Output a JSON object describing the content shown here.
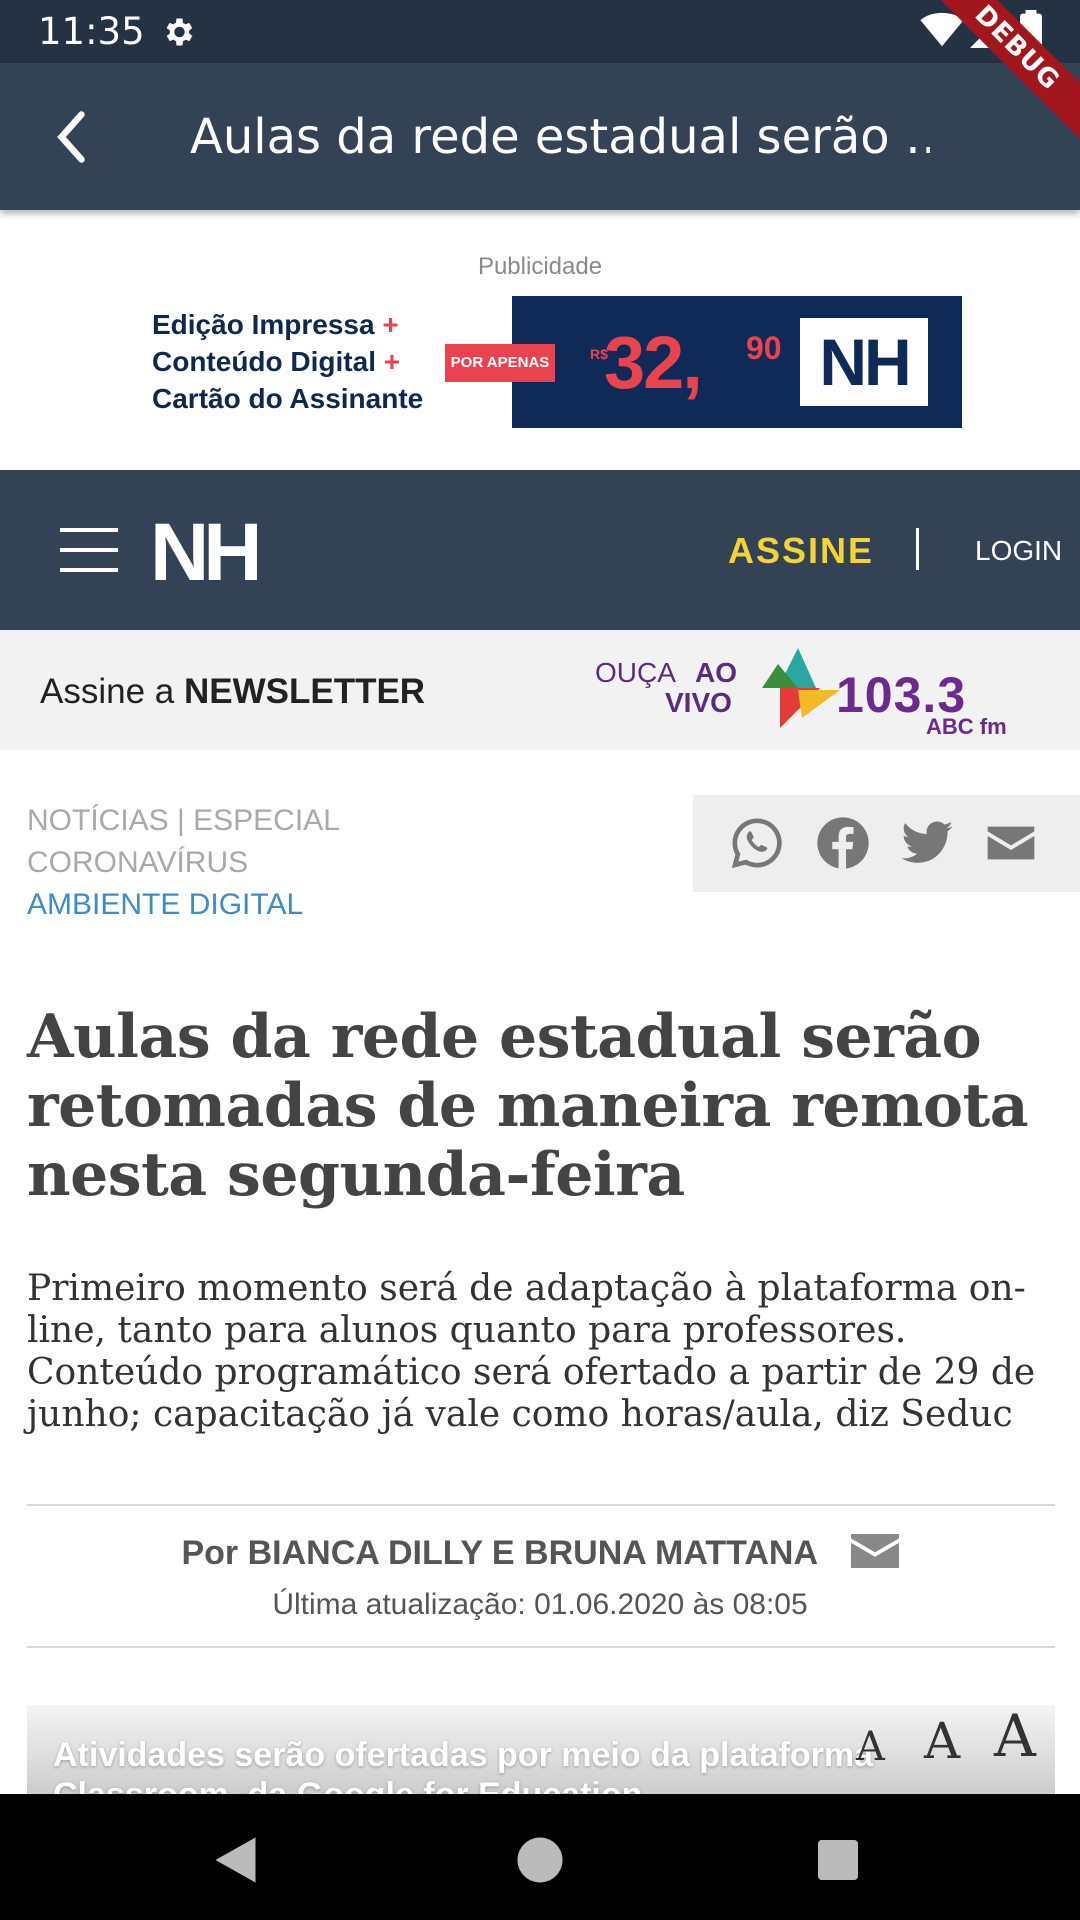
{
  "status_bar": {
    "time": "11:35"
  },
  "debug_banner": "DEBUG",
  "app_bar": {
    "title": "Aulas da rede estadual serão …"
  },
  "ad": {
    "label": "Publicidade",
    "line1": "Edição Impressa",
    "line2": "Conteúdo Digital",
    "line3": "Cartão do Assinante",
    "badge": "POR APENAS",
    "currency": "R$",
    "price": "32,",
    "cents": "90",
    "brand": "NH"
  },
  "site_header": {
    "logo": "NH",
    "assine": "ASSINE",
    "login": "LOGIN"
  },
  "strip": {
    "newsletter_prefix": "Assine a ",
    "newsletter_bold": "NEWSLETTER",
    "ouca": "OUÇA",
    "ao": "AO",
    "vivo": "VIVO",
    "frequency": "103.3",
    "station": "ABC fm"
  },
  "article": {
    "category1": "NOTÍCIAS | ESPECIAL",
    "category1b": "CORONAVÍRUS",
    "category2": "AMBIENTE DIGITAL",
    "headline": "Aulas da rede estadual serão retomadas de maneira remota nesta segunda-feira",
    "summary": "Primeiro momento será de adaptação à plataforma on-line, tanto para alunos quanto para professores. Conteúdo programático será ofertado a partir de 29 de junho; capacitação já vale como horas/aula, diz Seduc",
    "byline": "Por BIANCA DILLY E BRUNA MATTANA",
    "updated": "Última atualização: 01.06.2020 às 08:05",
    "photo_caption": "Atividades serão ofertadas por meio da plataforma Classroom, da Google for Education",
    "font_sizes": [
      "A",
      "A",
      "A"
    ]
  },
  "colors": {
    "app_bar": "#344256",
    "status_bar": "#243244",
    "assine": "#f2d436",
    "category_link": "#3d8cc8",
    "radio_purple": "#6b2a8c"
  }
}
